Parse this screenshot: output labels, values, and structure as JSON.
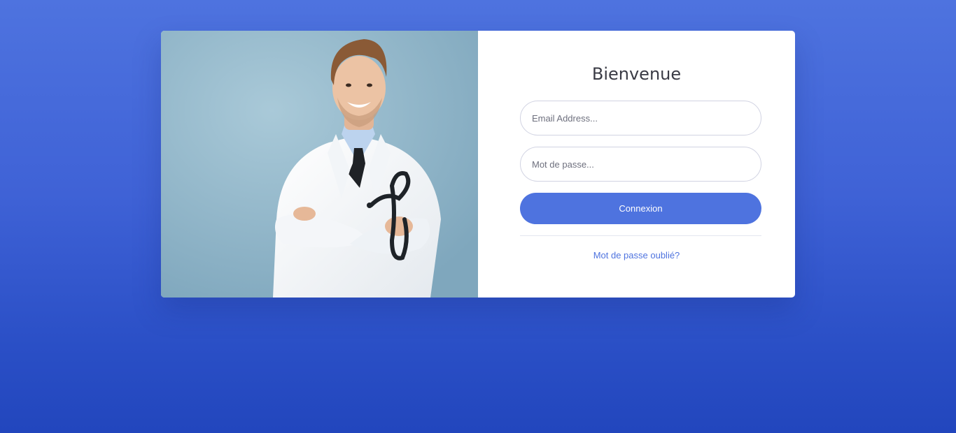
{
  "login": {
    "title": "Bienvenue",
    "email_placeholder": "Email Address...",
    "password_placeholder": "Mot de passe...",
    "submit_label": "Connexion",
    "forgot_label": "Mot de passe oublié?"
  },
  "photo": {
    "subject": "smiling doctor in white coat holding stethoscope"
  },
  "colors": {
    "primary": "#4e73df",
    "background_top": "#4e73df",
    "background_bottom": "#2246bd",
    "card": "#ffffff",
    "title_text": "#3a3b45",
    "input_border": "#d1d3e2"
  }
}
